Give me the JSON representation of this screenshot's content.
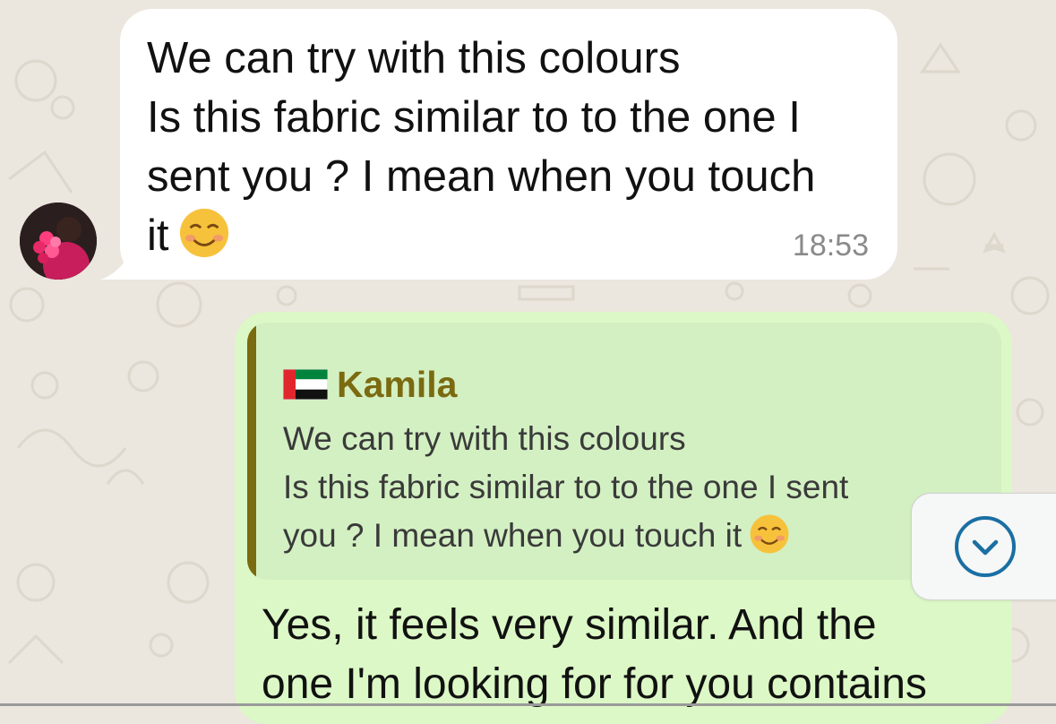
{
  "colors": {
    "wallpaper": "#ebe6de",
    "incoming_bubble": "#ffffff",
    "outgoing_bubble": "#dcf8c6",
    "quote_background": "#d3f0c2",
    "quote_accent": "#7a6a10",
    "scroll_button_icon": "#1a6fa3"
  },
  "incoming_message": {
    "text": "We can try with this colours\nIs this fabric similar to to the one I\nsent you ? I mean when you touch\nit",
    "emoji": "smiling-face-icon",
    "time": "18:53"
  },
  "outgoing_message": {
    "quoted": {
      "flag": "uae-flag-icon",
      "sender": "Kamila",
      "text": "We can try with this colours\nIs this fabric similar to to the one I sent\nyou ? I mean when you touch it"
    },
    "text": "Yes, it feels very similar. And the\none I'm looking for for you contains"
  },
  "scroll_button": {
    "icon": "chevron-down-icon"
  }
}
